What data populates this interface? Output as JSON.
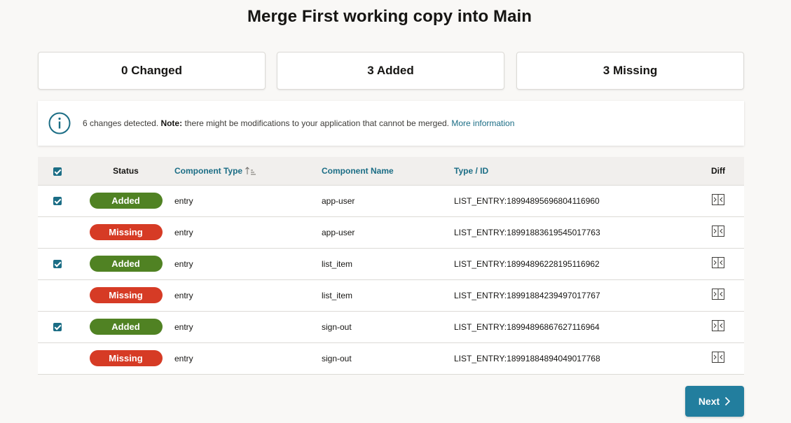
{
  "page": {
    "title": "Merge First working copy into Main"
  },
  "summary": [
    {
      "label": "0 Changed"
    },
    {
      "label": "3 Added"
    },
    {
      "label": "3 Missing"
    }
  ],
  "info": {
    "icon": "info-circle-icon",
    "text_prefix": "6 changes detected.",
    "note_label": "Note:",
    "note_text": "there might be modifications to your application that cannot be merged.",
    "link": "More information"
  },
  "table": {
    "headers": {
      "status": "Status",
      "component_type": "Component Type",
      "component_name": "Component Name",
      "type_id": "Type / ID",
      "diff": "Diff"
    },
    "sort_column": "component_type",
    "sort_direction": "ascending",
    "select_all_checked": true,
    "rows": [
      {
        "checked": true,
        "status": "Added",
        "type": "entry",
        "name": "app-user",
        "id": "LIST_ENTRY:18994895696804116960"
      },
      {
        "checked": false,
        "status": "Missing",
        "type": "entry",
        "name": "app-user",
        "id": "LIST_ENTRY:18991883619545017763"
      },
      {
        "checked": true,
        "status": "Added",
        "type": "entry",
        "name": "list_item",
        "id": "LIST_ENTRY:18994896228195116962"
      },
      {
        "checked": false,
        "status": "Missing",
        "type": "entry",
        "name": "list_item",
        "id": "LIST_ENTRY:18991884239497017767"
      },
      {
        "checked": true,
        "status": "Added",
        "type": "entry",
        "name": "sign-out",
        "id": "LIST_ENTRY:18994896867627116964"
      },
      {
        "checked": false,
        "status": "Missing",
        "type": "entry",
        "name": "sign-out",
        "id": "LIST_ENTRY:18991884894049017768"
      }
    ]
  },
  "footer": {
    "next_label": "Next",
    "next_icon": "chevron-right-icon"
  },
  "colors": {
    "added": "#508223",
    "missing": "#d63b25",
    "accent": "#227e9e",
    "link": "#1b6d85"
  }
}
